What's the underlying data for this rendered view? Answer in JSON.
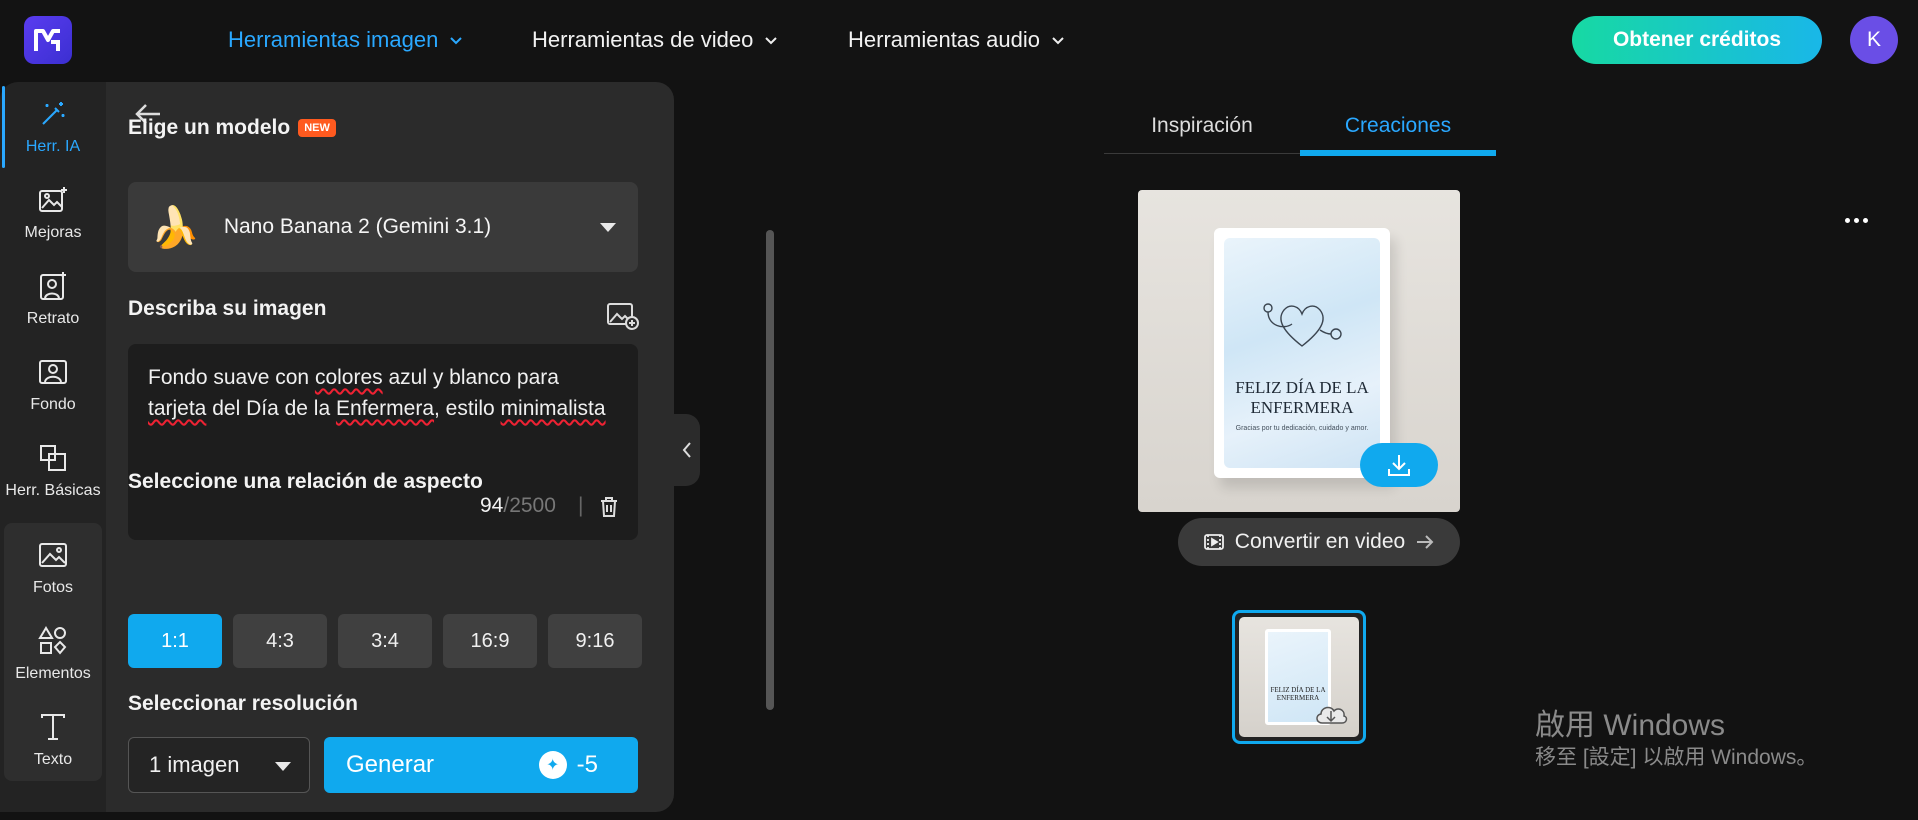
{
  "app": {
    "logo_alt": "M"
  },
  "nav": {
    "items": [
      {
        "label": "Herramientas imagen",
        "active": true
      },
      {
        "label": "Herramientas de video",
        "active": false
      },
      {
        "label": "Herramientas audio",
        "active": false
      }
    ],
    "credits_button": "Obtener créditos",
    "avatar_initial": "K"
  },
  "rail": {
    "items": [
      {
        "label": "Herr. IA",
        "icon": "magic-wand-icon",
        "active": true
      },
      {
        "label": "Mejoras",
        "icon": "image-enhance-icon"
      },
      {
        "label": "Retrato",
        "icon": "portrait-icon"
      },
      {
        "label": "Fondo",
        "icon": "background-icon"
      },
      {
        "label": "Herr. Básicas",
        "icon": "crop-icon"
      },
      {
        "label": "Fotos",
        "icon": "photos-icon"
      },
      {
        "label": "Elementos",
        "icon": "elements-icon"
      },
      {
        "label": "Texto",
        "icon": "text-icon"
      }
    ]
  },
  "panel": {
    "model_label": "Elige un modelo",
    "new_badge": "NEW",
    "model_value": "Nano Banana 2 (Gemini 3.1)",
    "model_emoji": "🍌",
    "prompt_label": "Describa su imagen",
    "prompt_text_parts": [
      "Fondo suave con ",
      "colores",
      " azul y blanco para ",
      "tarjeta",
      " del Día de la ",
      "Enfermera",
      ", estilo ",
      "minimalista"
    ],
    "char_count": "94",
    "char_max": "/2500",
    "char_sep": "|",
    "aspect_label": "Seleccione una relación de aspecto",
    "aspect_options": [
      "1:1",
      "4:3",
      "3:4",
      "16:9",
      "9:16"
    ],
    "aspect_selected": "1:1",
    "resolution_label": "Seleccionar resolución",
    "count_value": "1 imagen",
    "generate_label": "Generar",
    "generate_cost": "-5"
  },
  "main": {
    "tabs": [
      {
        "label": "Inspiración",
        "active": false
      },
      {
        "label": "Creaciones",
        "active": true
      }
    ],
    "card_title": "FELIZ DÍA DE LA ENFERMERA",
    "card_subtitle": "Gracias por tu dedicación, cuidado y amor.",
    "convert_label": "Convertir en video",
    "thumb_title": "FELIZ DÍA DE LA ENFERMERA"
  },
  "watermark": {
    "line1": "啟用 Windows",
    "line2": "移至 [設定] 以啟用 Windows。"
  },
  "colors": {
    "accent": "#10a9ee",
    "nav_active": "#2aa8ff",
    "credits_gradient_start": "#17d9a3",
    "credits_gradient_end": "#19b7e8",
    "new_badge": "#ff5a1f"
  }
}
